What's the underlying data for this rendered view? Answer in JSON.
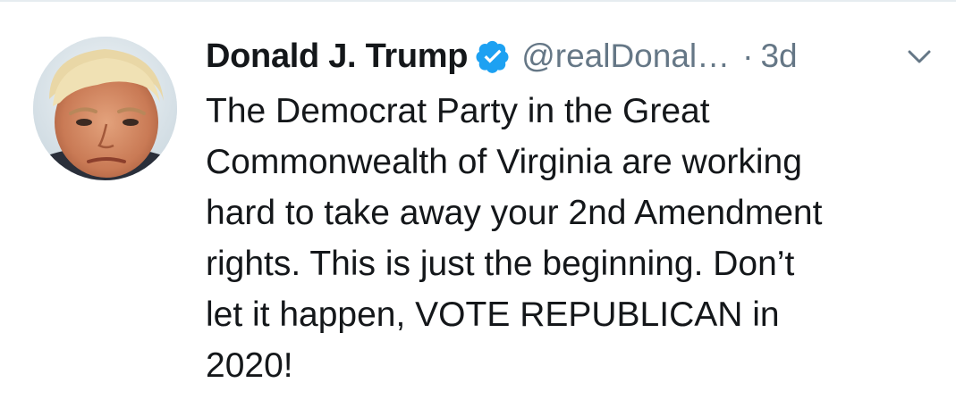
{
  "author": {
    "display_name": "Donald J. Trump",
    "handle": "@realDonal…",
    "verified": true,
    "verified_icon": "verified-badge-icon",
    "avatar": "profile-photo"
  },
  "meta": {
    "separator": "·",
    "timestamp": "3d",
    "menu_icon": "chevron-down-icon"
  },
  "tweet": {
    "lines": [
      "The Democrat Party in the Great",
      "Commonwealth of Virginia are working",
      "hard to take away your 2nd Amendment",
      "rights. This is just the beginning. Don’t",
      "let it happen, VOTE REPUBLICAN in",
      "2020!"
    ]
  },
  "colors": {
    "text_primary": "#14171a",
    "text_secondary": "#657786",
    "verified_blue": "#1da1f2",
    "divider": "#e6ecf0"
  }
}
